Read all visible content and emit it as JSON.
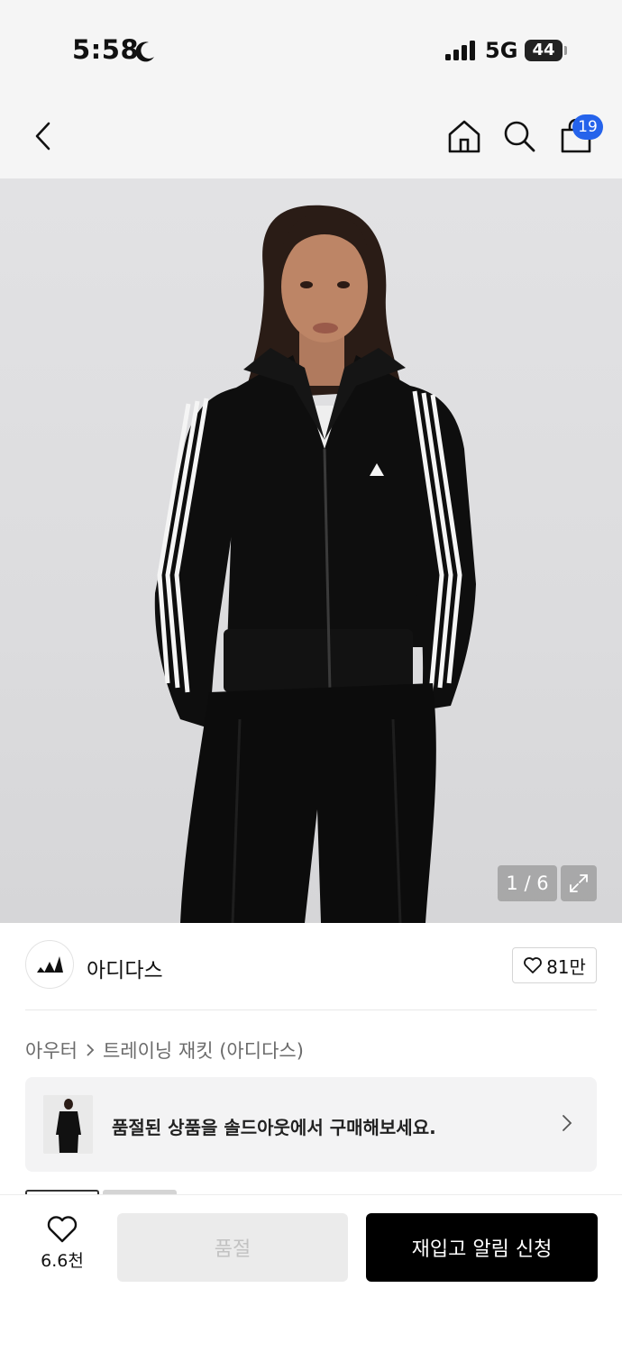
{
  "status_bar": {
    "time": "5:58",
    "network": "5G",
    "battery": "44"
  },
  "header": {
    "cart_count": "19"
  },
  "product": {
    "image_counter": "1 / 6",
    "brand_name": "아디다스",
    "like_count": "81만",
    "breadcrumb": [
      "아우터",
      "트레이닝 재킷 (아디다스)"
    ]
  },
  "banner": {
    "text": "품절된 상품을 솔드아웃에서 구매해보세요."
  },
  "bottom_bar": {
    "wish_count": "6.6천",
    "soldout_label": "품절",
    "restock_label": "재입고 알림 신청"
  },
  "icons": {
    "back": "chevron-left-icon",
    "home": "home-icon",
    "search": "search-icon",
    "cart": "shopping-bag-icon",
    "expand": "expand-icon",
    "heart": "heart-icon"
  }
}
